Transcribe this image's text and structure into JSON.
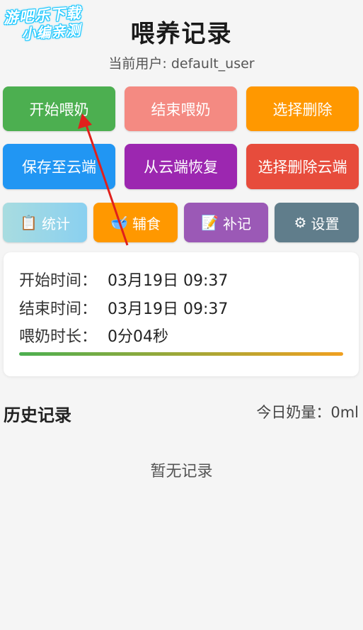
{
  "watermark": {
    "line1": "游吧乐下载",
    "line2": "小编亲测"
  },
  "header": {
    "title": "喂养记录",
    "user_text": "当前用户: default_user"
  },
  "actions": {
    "start_feeding": "开始喂奶",
    "end_feeding": "结束喂奶",
    "select_delete": "选择删除",
    "save_cloud": "保存至云端",
    "restore_cloud": "从云端恢复",
    "select_delete_cloud": "选择删除云端"
  },
  "nav": {
    "stats": {
      "icon": "📋",
      "icon_name": "clipboard-icon",
      "label": "统计"
    },
    "food": {
      "icon": "🥣",
      "icon_name": "bowl-icon",
      "label": "辅食"
    },
    "add": {
      "icon": "📝",
      "icon_name": "memo-icon",
      "label": "补记"
    },
    "settings": {
      "icon": "⚙",
      "icon_name": "gear-icon",
      "label": "设置"
    }
  },
  "session": {
    "start_label": "开始时间：",
    "start_value": "03月19日 09:37",
    "end_label": "结束时间：",
    "end_value": "03月19日 09:37",
    "duration_label": "喂奶时长：",
    "duration_value": "0分04秒"
  },
  "history": {
    "title": "历史记录",
    "today_amount": "今日奶量：0ml",
    "empty_text": "暂无记录"
  },
  "colors": {
    "green": "#4caf50",
    "salmon": "#f48a82",
    "orange": "#ff9800",
    "blue": "#2196f3",
    "purple": "#9c27b0",
    "red": "#f44336",
    "slate": "#607d8b",
    "annotation_arrow": "#e0201c"
  }
}
